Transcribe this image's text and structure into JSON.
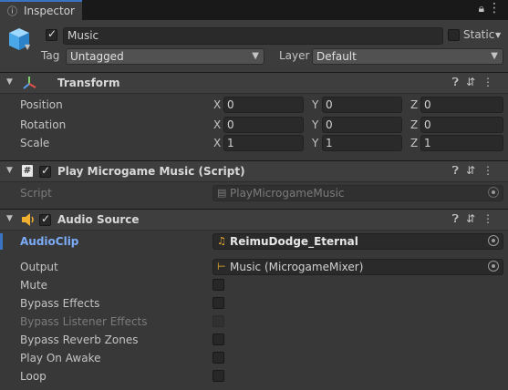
{
  "tab": {
    "label": "Inspector"
  },
  "header": {
    "object_name": "Music",
    "static_label": "Static",
    "tag_label": "Tag",
    "tag_value": "Untagged",
    "layer_label": "Layer",
    "layer_value": "Default"
  },
  "transform": {
    "title": "Transform",
    "rows": [
      {
        "label": "Position",
        "x": "0",
        "y": "0",
        "z": "0"
      },
      {
        "label": "Rotation",
        "x": "0",
        "y": "0",
        "z": "0"
      },
      {
        "label": "Scale",
        "x": "1",
        "y": "1",
        "z": "1"
      }
    ],
    "axes": {
      "x": "X",
      "y": "Y",
      "z": "Z"
    }
  },
  "script_comp": {
    "title": "Play Microgame Music (Script)",
    "script_label": "Script",
    "script_value": "PlayMicrogameMusic"
  },
  "audio": {
    "title": "Audio Source",
    "audioclip_label": "AudioClip",
    "audioclip_value": "ReimuDodge_Eternal",
    "output_label": "Output",
    "output_value": "Music (MicrogameMixer)",
    "toggles": [
      {
        "label": "Mute",
        "checked": false,
        "disabled": false
      },
      {
        "label": "Bypass Effects",
        "checked": false,
        "disabled": false
      },
      {
        "label": "Bypass Listener Effects",
        "checked": false,
        "disabled": true
      },
      {
        "label": "Bypass Reverb Zones",
        "checked": false,
        "disabled": false
      },
      {
        "label": "Play On Awake",
        "checked": false,
        "disabled": false
      },
      {
        "label": "Loop",
        "checked": false,
        "disabled": false
      }
    ]
  },
  "icons": {
    "tab": "info-icon",
    "lock": "lock-icon",
    "menu": "kebab-menu-icon",
    "gameobject": "cube-icon",
    "transform": "transform-axes-icon",
    "script": "script-hash-icon",
    "audio": "speaker-icon",
    "help": "help-icon",
    "presets": "presets-icon",
    "more": "more-icon"
  },
  "colors": {
    "accent": "#3a72c4",
    "link_label": "#7cacf8",
    "background": "#383838"
  }
}
